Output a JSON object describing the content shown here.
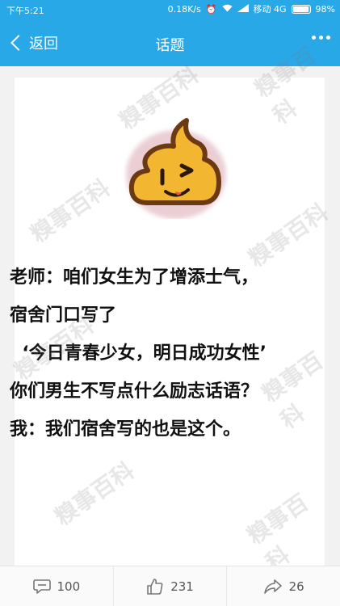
{
  "status_bar": {
    "time": "下午5:21",
    "speed": "0.18K/s",
    "carrier": "移动 4G",
    "battery": "98%",
    "battery_level": 0.98
  },
  "navbar": {
    "back_label": "返回",
    "title": "话题"
  },
  "post": {
    "lines": [
      "老师：咱们女生为了增添士气，",
      "宿舍门口写了",
      "  ‘今日青春少女，明日成功女性’",
      "你们男生不写点什么励志话语？",
      "我：我们宿舍写的也是这个。"
    ]
  },
  "actions": {
    "comments": "100",
    "likes": "231",
    "shares": "26"
  },
  "watermark": "糗事百科",
  "colors": {
    "accent": "#29a8e8",
    "poop": "#f2b630"
  }
}
